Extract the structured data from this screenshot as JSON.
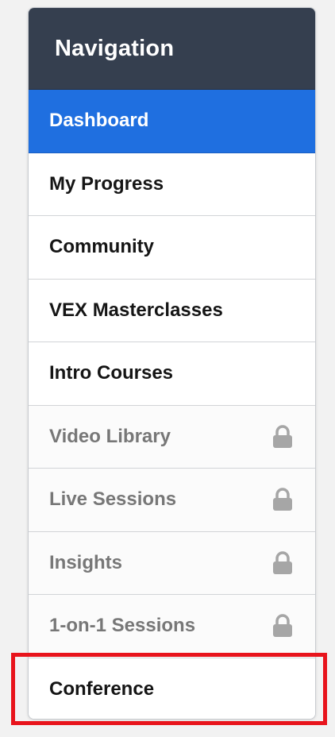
{
  "nav": {
    "title": "Navigation",
    "items": [
      {
        "label": "Dashboard",
        "state": "active"
      },
      {
        "label": "My Progress",
        "state": "normal"
      },
      {
        "label": "Community",
        "state": "normal"
      },
      {
        "label": "VEX Masterclasses",
        "state": "normal"
      },
      {
        "label": "Intro Courses",
        "state": "normal"
      },
      {
        "label": "Video Library",
        "state": "locked",
        "icon": "lock-icon"
      },
      {
        "label": "Live Sessions",
        "state": "locked",
        "icon": "lock-icon"
      },
      {
        "label": "Insights",
        "state": "locked",
        "icon": "lock-icon"
      },
      {
        "label": "1-on-1 Sessions",
        "state": "locked",
        "icon": "lock-icon"
      },
      {
        "label": "Conference",
        "state": "normal",
        "highlighted": true
      }
    ]
  },
  "colors": {
    "header_bg": "#353f4f",
    "active_bg": "#1f6fe0",
    "locked_text": "#777777",
    "highlight": "#e8141c"
  }
}
